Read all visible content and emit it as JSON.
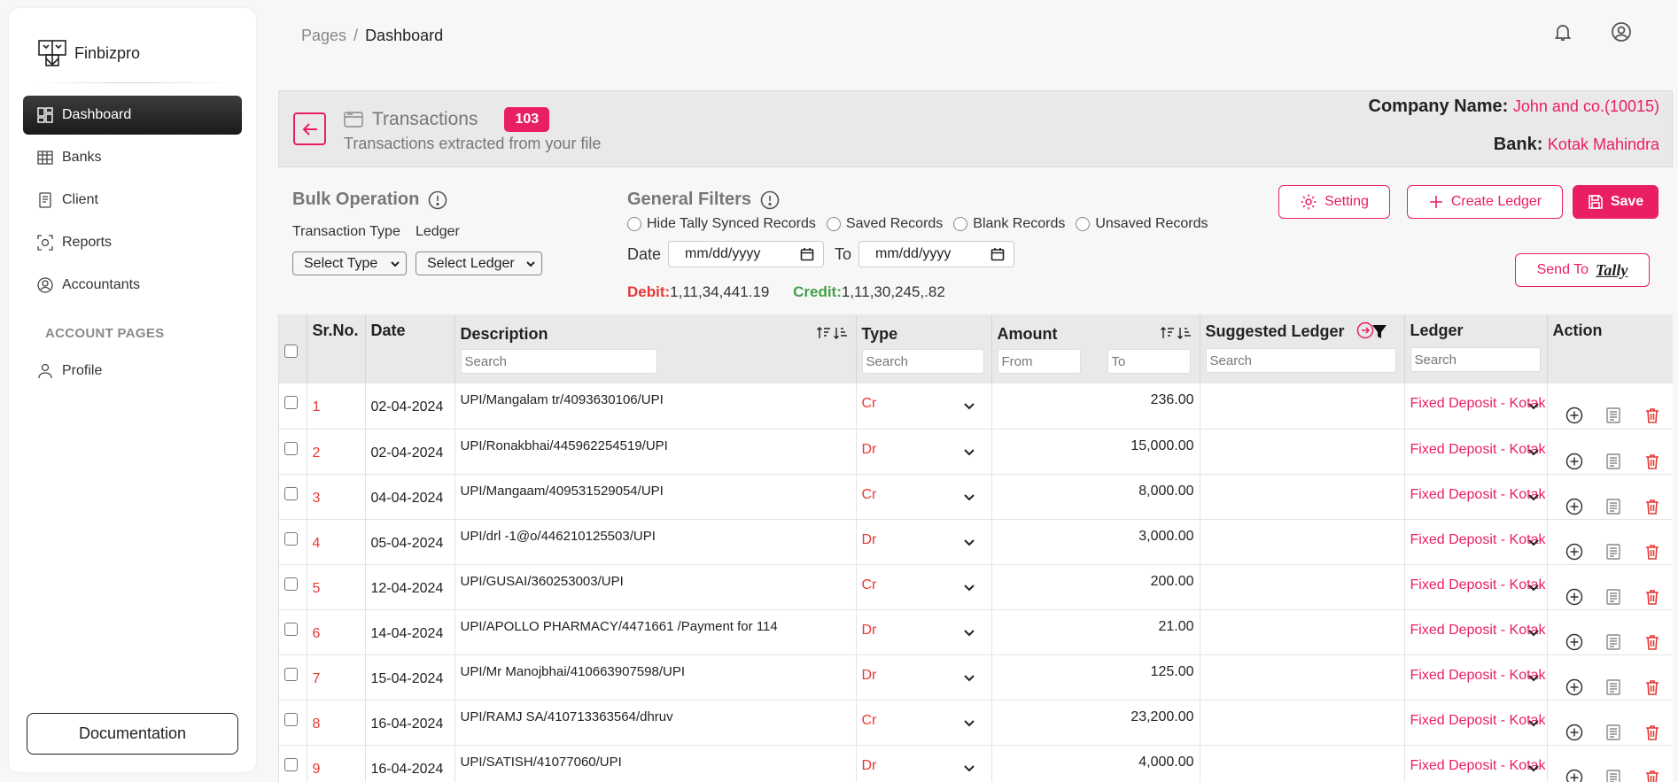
{
  "sidebar": {
    "brand": "Finbizpro",
    "items": [
      {
        "label": "Dashboard",
        "icon": "dashboard-icon",
        "active": true
      },
      {
        "label": "Banks",
        "icon": "table-icon"
      },
      {
        "label": "Client",
        "icon": "document-icon"
      },
      {
        "label": "Reports",
        "icon": "reports-icon"
      },
      {
        "label": "Accountants",
        "icon": "user-circle-icon"
      }
    ],
    "section_label": "ACCOUNT PAGES",
    "profile_label": "Profile",
    "documentation_label": "Documentation"
  },
  "breadcrumb": {
    "parent": "Pages",
    "separator": "/",
    "current": "Dashboard"
  },
  "header": {
    "title": "Transactions",
    "count": "103",
    "subtitle": "Transactions extracted from your file",
    "company_label": "Company Name:",
    "company_value": "John and co.(10015)",
    "bank_label": "Bank:",
    "bank_value": "Kotak Mahindra"
  },
  "bulk": {
    "title": "Bulk Operation",
    "type_label": "Transaction Type",
    "ledger_label": "Ledger",
    "type_select": "Select Type",
    "ledger_select": "Select Ledger"
  },
  "filters": {
    "title": "General Filters",
    "checks": [
      "Hide Tally Synced Records",
      "Saved Records",
      "Blank Records",
      "Unsaved Records"
    ],
    "date_label": "Date",
    "to_label": "To",
    "date_placeholder": "mm/dd/yyyy",
    "debit_label": "Debit:",
    "debit_value": "1,11,34,441.19",
    "credit_label": "Credit:",
    "credit_value": "1,11,30,245,.82"
  },
  "buttons": {
    "setting": "Setting",
    "create_ledger": "Create Ledger",
    "save": "Save",
    "send_to": "Send To",
    "tally": "Tally"
  },
  "table": {
    "headers": {
      "srno": "Sr.No.",
      "date": "Date",
      "description": "Description",
      "type": "Type",
      "amount": "Amount",
      "suggested": "Suggested Ledger",
      "ledger": "Ledger",
      "action": "Action"
    },
    "search_placeholder": "Search",
    "from_placeholder": "From",
    "to_placeholder": "To",
    "rows": [
      {
        "sr": "1",
        "date": "02-04-2024",
        "desc": "UPI/Mangalam tr/4093630106/UPI",
        "type": "Cr",
        "amount": "236.00",
        "ledger": "Fixed Deposit - Kotak"
      },
      {
        "sr": "2",
        "date": "02-04-2024",
        "desc": "UPI/Ronakbhai/445962254519/UPI",
        "type": "Dr",
        "amount": "15,000.00",
        "ledger": "Fixed Deposit - Kotak"
      },
      {
        "sr": "3",
        "date": "04-04-2024",
        "desc": "UPI/Mangaam/409531529054/UPI",
        "type": "Cr",
        "amount": "8,000.00",
        "ledger": "Fixed Deposit - Kotak"
      },
      {
        "sr": "4",
        "date": "05-04-2024",
        "desc": "UPI/drl -1@o/446210125503/UPI",
        "type": "Dr",
        "amount": "3,000.00",
        "ledger": "Fixed Deposit - Kotak"
      },
      {
        "sr": "5",
        "date": "12-04-2024",
        "desc": "UPI/GUSAI/360253003/UPI",
        "type": "Cr",
        "amount": "200.00",
        "ledger": "Fixed Deposit - Kotak"
      },
      {
        "sr": "6",
        "date": "14-04-2024",
        "desc": "UPI/APOLLO PHARMACY/4471661 /Payment for 114",
        "type": "Dr",
        "amount": "21.00",
        "ledger": "Fixed Deposit - Kotak"
      },
      {
        "sr": "7",
        "date": "15-04-2024",
        "desc": "UPI/Mr Manojbhai/410663907598/UPI",
        "type": "Dr",
        "amount": "125.00",
        "ledger": "Fixed Deposit - Kotak"
      },
      {
        "sr": "8",
        "date": "16-04-2024",
        "desc": "UPI/RAMJ SA/410713363564/dhruv",
        "type": "Cr",
        "amount": "23,200.00",
        "ledger": "Fixed Deposit - Kotak"
      },
      {
        "sr": "9",
        "date": "16-04-2024",
        "desc": "UPI/SATISH/41077060/UPI",
        "type": "Dr",
        "amount": "4,000.00",
        "ledger": "Fixed Deposit - Kotak"
      }
    ]
  },
  "colors": {
    "accent": "#e91e63",
    "debit": "#e53935",
    "credit": "#43a047"
  }
}
